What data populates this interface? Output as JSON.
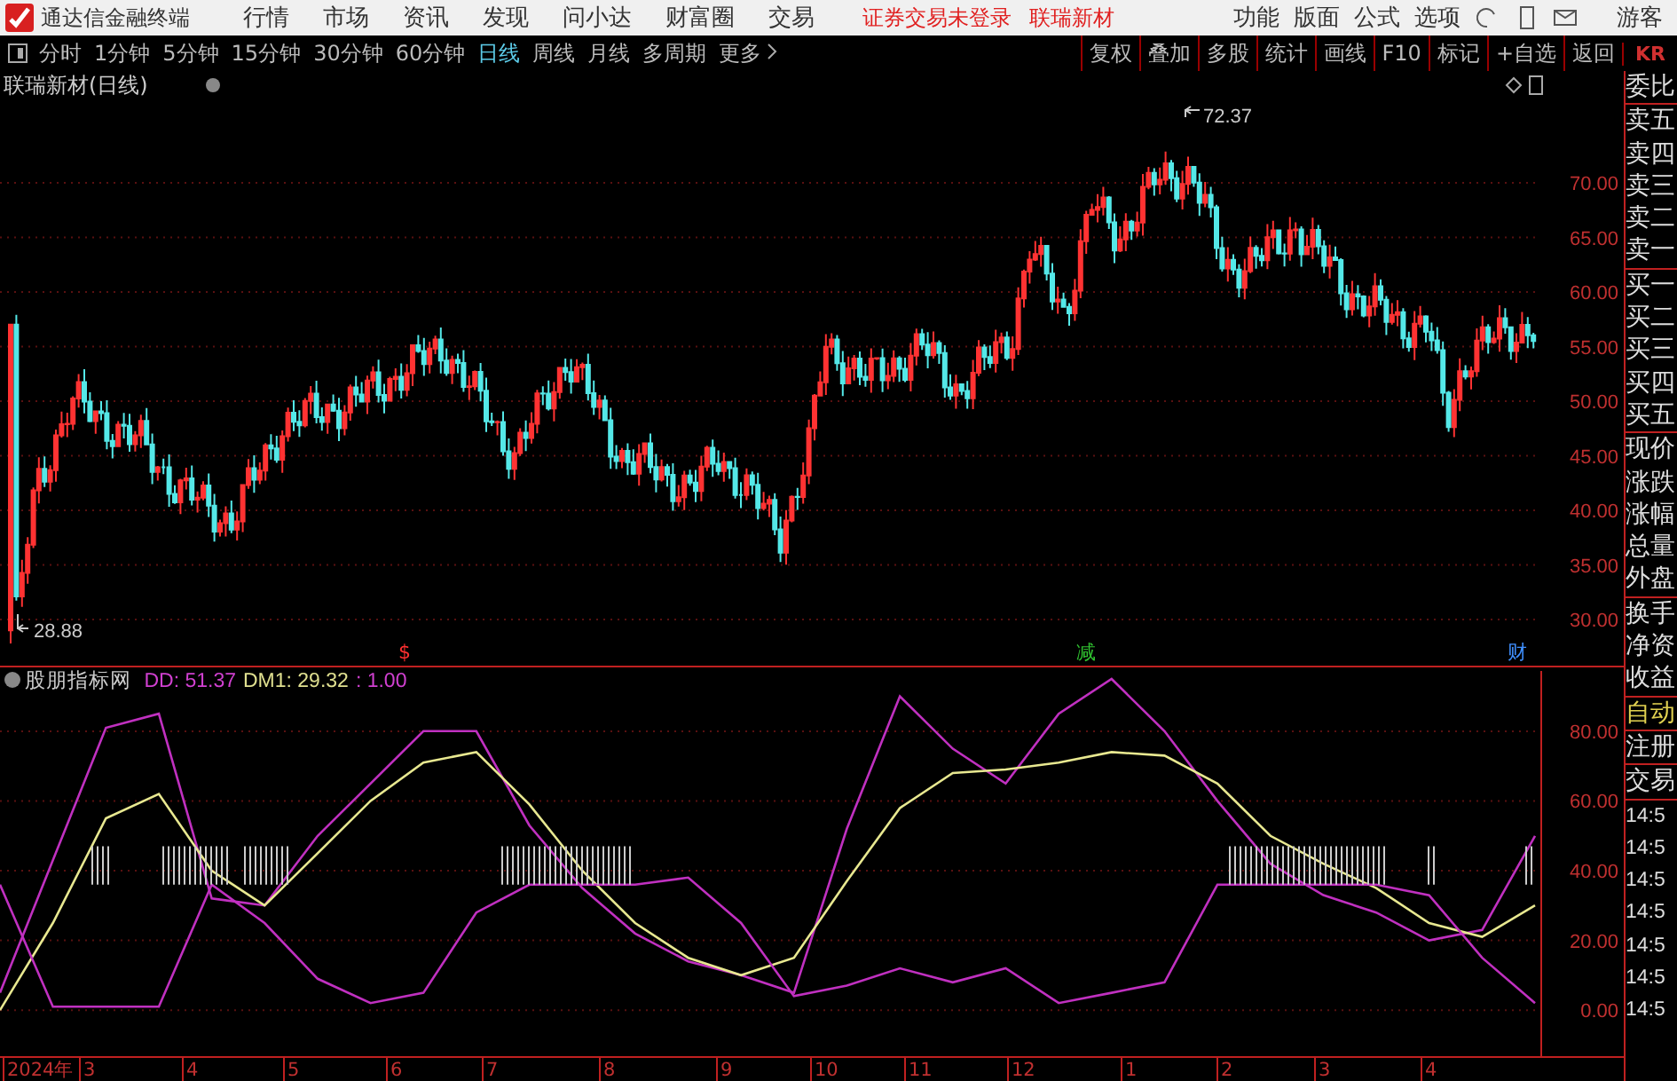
{
  "app": {
    "title": "通达信金融终端",
    "menu": [
      "行情",
      "市场",
      "资讯",
      "发现",
      "问小达",
      "财富圈",
      "交易"
    ],
    "notice": "证券交易未登录",
    "stock_link": "联瑞新材",
    "tools": [
      "功能",
      "版面",
      "公式",
      "选项"
    ],
    "user": "游客"
  },
  "periods": [
    {
      "label": "分时",
      "selected": false
    },
    {
      "label": "1分钟",
      "selected": false
    },
    {
      "label": "5分钟",
      "selected": false
    },
    {
      "label": "15分钟",
      "selected": false
    },
    {
      "label": "30分钟",
      "selected": false
    },
    {
      "label": "60分钟",
      "selected": false
    },
    {
      "label": "日线",
      "selected": true
    },
    {
      "label": "周线",
      "selected": false
    },
    {
      "label": "月线",
      "selected": false
    },
    {
      "label": "多周期",
      "selected": false
    },
    {
      "label": "更多",
      "selected": false
    }
  ],
  "toolbar_buttons": [
    "复权",
    "叠加",
    "多股",
    "统计",
    "画线",
    "F10",
    "标记",
    "+自选",
    "返回"
  ],
  "corner_label": "KR",
  "chart": {
    "title": "联瑞新材(日线)",
    "high_label": "72.37",
    "low_label": "28.88",
    "price_axis": [
      "70.00",
      "65.00",
      "60.00",
      "55.00",
      "50.00",
      "45.00",
      "40.00",
      "35.00",
      "30.00"
    ],
    "events": [
      {
        "label": "$",
        "color": "#ff3030"
      },
      {
        "label": "减",
        "color": "#30c030"
      },
      {
        "label": "财",
        "color": "#4090ff"
      }
    ]
  },
  "indicator": {
    "name": "股朋指标网",
    "values": [
      {
        "text": "DD: 51.37",
        "color": "#d040d0"
      },
      {
        "text": "DM1: 29.32",
        "color": "#e0e090"
      },
      {
        "text": ": 1.00",
        "color": "#d040d0"
      }
    ],
    "chart_data": {
      "type": "line",
      "ylim": [
        -13.2,
        98.3
      ],
      "grid": true,
      "yticks": [
        {
          "value": 80,
          "label": "80.00"
        },
        {
          "value": 60,
          "label": "60.00"
        },
        {
          "value": 40,
          "label": "40.00"
        },
        {
          "value": 20,
          "label": "20.00"
        },
        {
          "value": 0,
          "label": "0.00"
        }
      ],
      "series": [
        {
          "color": "#c030c0",
          "values": [
            5,
            43,
            81,
            85,
            32,
            30,
            50,
            65,
            80,
            80,
            53,
            35,
            22,
            14,
            10,
            5,
            52,
            90,
            75,
            65,
            85,
            95,
            80,
            60,
            42,
            33,
            28,
            20,
            23,
            50
          ]
        },
        {
          "color": "#e8e890",
          "values": [
            0,
            25,
            55,
            62,
            40,
            30,
            45,
            60,
            71,
            74,
            59,
            40,
            25,
            15,
            10,
            15,
            37,
            58,
            68,
            69,
            71,
            74,
            73,
            65,
            50,
            42,
            35,
            25,
            21,
            30
          ]
        },
        {
          "color": "#c030c0",
          "values": [
            36,
            1,
            1,
            1,
            36,
            25,
            9,
            2,
            5,
            28,
            36,
            36,
            36,
            38,
            25,
            4,
            7,
            12,
            8,
            12,
            2,
            5,
            8,
            36,
            36,
            36,
            36,
            33,
            15,
            2
          ]
        }
      ]
    }
  },
  "x_axis": [
    "2024年",
    "3",
    "4",
    "5",
    "6",
    "7",
    "8",
    "9",
    "10",
    "11",
    "12",
    "1",
    "2",
    "3",
    "4"
  ],
  "side_panel": {
    "quote_groups": [
      [
        "委比"
      ],
      [
        "卖五",
        "卖四",
        "卖三",
        "卖二",
        "卖一"
      ],
      [
        "买一",
        "买二",
        "买三",
        "买四",
        "买五"
      ],
      [
        "现价",
        "涨跌",
        "涨幅",
        "总量",
        "外盘"
      ],
      [
        "换手",
        "净资",
        "收益"
      ]
    ],
    "auto_label": "自动",
    "links": [
      "注册",
      "交易"
    ],
    "times": [
      "14:5",
      "14:5",
      "14:5",
      "14:5",
      "14:5",
      "14:5",
      "14:5"
    ]
  }
}
